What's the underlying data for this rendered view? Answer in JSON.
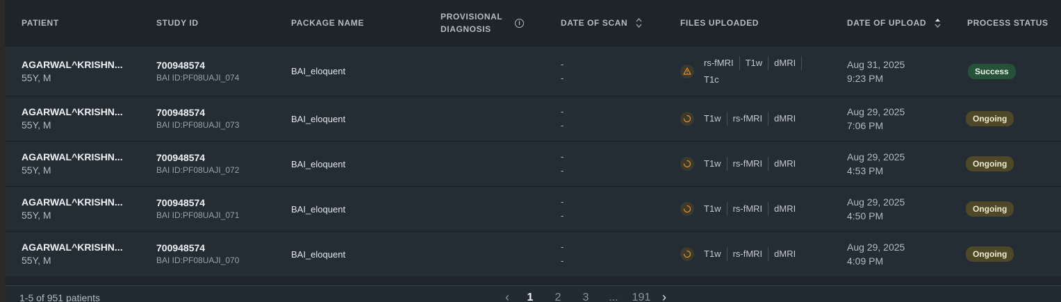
{
  "headers": {
    "patient": "PATIENT",
    "study_id": "STUDY ID",
    "package_name": "PACKAGE NAME",
    "provisional_1": "PROVISIONAL",
    "provisional_2": "DIAGNOSIS",
    "date_of_scan": "DATE OF SCAN",
    "files_uploaded": "FILES UPLOADED",
    "date_of_upload": "DATE OF UPLOAD",
    "process_status": "PROCESS STATUS"
  },
  "rows": [
    {
      "patient_name": "AGARWAL^KRISHN...",
      "patient_meta": "55Y, M",
      "study_id": "700948574",
      "bai_id": "BAI ID:PF08UAJI_074",
      "package": "BAI_eloquent",
      "scan_line1": "-",
      "scan_line2": "-",
      "file_status_icon": "warning-icon",
      "files": [
        "rs-fMRI",
        "T1w",
        "dMRI",
        "T1c"
      ],
      "upload_date": "Aug 31, 2025",
      "upload_time": "9:23 PM",
      "status": "Success"
    },
    {
      "patient_name": "AGARWAL^KRISHN...",
      "patient_meta": "55Y, M",
      "study_id": "700948574",
      "bai_id": "BAI ID:PF08UAJI_073",
      "package": "BAI_eloquent",
      "scan_line1": "-",
      "scan_line2": "-",
      "file_status_icon": "loading-icon",
      "files": [
        "T1w",
        "rs-fMRI",
        "dMRI"
      ],
      "upload_date": "Aug 29, 2025",
      "upload_time": "7:06 PM",
      "status": "Ongoing"
    },
    {
      "patient_name": "AGARWAL^KRISHN...",
      "patient_meta": "55Y, M",
      "study_id": "700948574",
      "bai_id": "BAI ID:PF08UAJI_072",
      "package": "BAI_eloquent",
      "scan_line1": "-",
      "scan_line2": "-",
      "file_status_icon": "loading-icon",
      "files": [
        "T1w",
        "rs-fMRI",
        "dMRI"
      ],
      "upload_date": "Aug 29, 2025",
      "upload_time": "4:53 PM",
      "status": "Ongoing"
    },
    {
      "patient_name": "AGARWAL^KRISHN...",
      "patient_meta": "55Y, M",
      "study_id": "700948574",
      "bai_id": "BAI ID:PF08UAJI_071",
      "package": "BAI_eloquent",
      "scan_line1": "-",
      "scan_line2": "-",
      "file_status_icon": "loading-icon",
      "files": [
        "T1w",
        "rs-fMRI",
        "dMRI"
      ],
      "upload_date": "Aug 29, 2025",
      "upload_time": "4:50 PM",
      "status": "Ongoing"
    },
    {
      "patient_name": "AGARWAL^KRISHN...",
      "patient_meta": "55Y, M",
      "study_id": "700948574",
      "bai_id": "BAI ID:PF08UAJI_070",
      "package": "BAI_eloquent",
      "scan_line1": "-",
      "scan_line2": "-",
      "file_status_icon": "loading-icon",
      "files": [
        "T1w",
        "rs-fMRI",
        "dMRI"
      ],
      "upload_date": "Aug 29, 2025",
      "upload_time": "4:09 PM",
      "status": "Ongoing"
    }
  ],
  "footer": {
    "count_text": "1-5 of 951 patients",
    "pages": [
      "1",
      "2",
      "3",
      "...",
      "191"
    ],
    "current_page": "1",
    "prev_icon": "chevron-left-icon",
    "next_icon": "chevron-right-icon"
  },
  "colors": {
    "success": "#265337",
    "ongoing": "#4f4828",
    "warning": "#e0902f"
  }
}
